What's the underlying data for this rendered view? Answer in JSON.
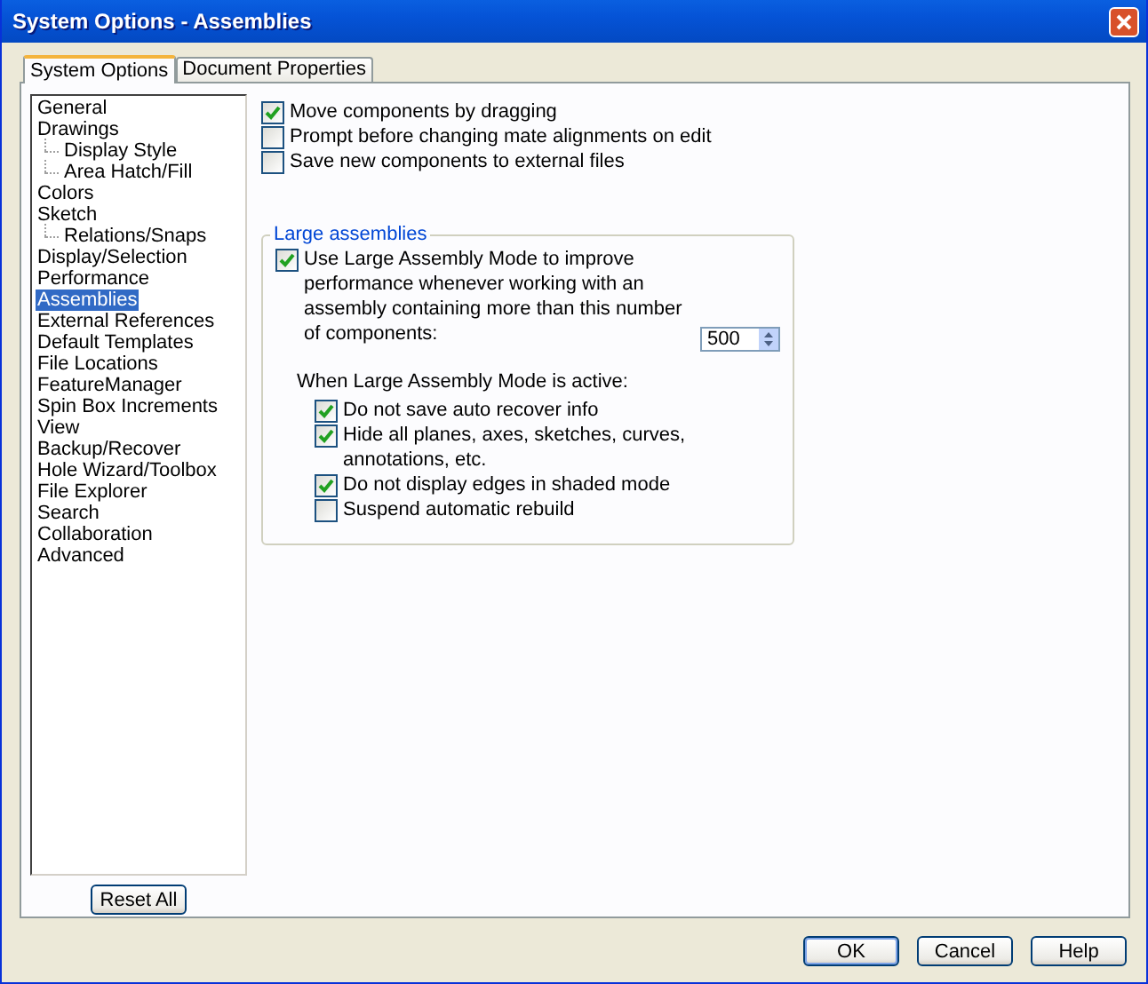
{
  "window": {
    "title": "System Options - Assemblies"
  },
  "tabs": [
    {
      "label": "System Options",
      "selected": true
    },
    {
      "label": "Document Properties",
      "selected": false
    }
  ],
  "sidebar": {
    "items": [
      {
        "label": "General",
        "selected": false
      },
      {
        "label": "Drawings",
        "selected": false,
        "children": [
          {
            "label": "Display Style",
            "selected": false
          },
          {
            "label": "Area Hatch/Fill",
            "selected": false
          }
        ]
      },
      {
        "label": "Colors",
        "selected": false
      },
      {
        "label": "Sketch",
        "selected": false,
        "children": [
          {
            "label": "Relations/Snaps",
            "selected": false
          }
        ]
      },
      {
        "label": "Display/Selection",
        "selected": false
      },
      {
        "label": "Performance",
        "selected": false
      },
      {
        "label": "Assemblies",
        "selected": true
      },
      {
        "label": "External References",
        "selected": false
      },
      {
        "label": "Default Templates",
        "selected": false
      },
      {
        "label": "File Locations",
        "selected": false
      },
      {
        "label": "FeatureManager",
        "selected": false
      },
      {
        "label": "Spin Box Increments",
        "selected": false
      },
      {
        "label": "View",
        "selected": false
      },
      {
        "label": "Backup/Recover",
        "selected": false
      },
      {
        "label": "Hole Wizard/Toolbox",
        "selected": false
      },
      {
        "label": "File Explorer",
        "selected": false
      },
      {
        "label": "Search",
        "selected": false
      },
      {
        "label": "Collaboration",
        "selected": false
      },
      {
        "label": "Advanced",
        "selected": false
      }
    ],
    "reset_button": "Reset All"
  },
  "options": [
    {
      "label": "Move components by dragging",
      "checked": true
    },
    {
      "label": "Prompt before changing mate alignments on edit",
      "checked": false
    },
    {
      "label": "Save new components to external files",
      "checked": false
    }
  ],
  "large_assemblies": {
    "title": "Large assemblies",
    "use_mode": {
      "label": "Use Large Assembly Mode to improve performance whenever working with an assembly containing more than this number of components:",
      "checked": true
    },
    "component_count": {
      "value": "500"
    },
    "active_heading": "When Large Assembly Mode is active:",
    "options": [
      {
        "label": "Do not save auto recover info",
        "checked": true
      },
      {
        "label": "Hide all planes, axes, sketches, curves, annotations, etc.",
        "checked": true
      },
      {
        "label": "Do not display edges in shaded mode",
        "checked": true
      },
      {
        "label": "Suspend automatic rebuild",
        "checked": false
      }
    ]
  },
  "buttons": [
    "OK",
    "Cancel",
    "Help"
  ]
}
